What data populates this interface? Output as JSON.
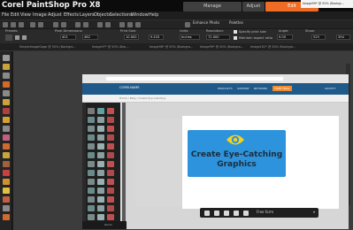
{
  "app": {
    "title": "Corel PaintShop Pro X8"
  },
  "workspace_tabs": {
    "manage": "Manage",
    "adjust": "Adjust",
    "edit": "Edit"
  },
  "menu": [
    "File",
    "Edit",
    "View",
    "Image",
    "Adjust",
    "Effects",
    "Layers",
    "Objects",
    "Selections",
    "Window",
    "Help"
  ],
  "toolbar": {
    "enhance_photo": "Enhance Photo",
    "palettes": "Palettes"
  },
  "tool_options": {
    "presets_label": "Presets:",
    "pixel_dimensions_label": "Pixel Dimensions:",
    "width_value": "401",
    "height_value": "462",
    "print_size_label": "Print Size:",
    "print_w": "10.000",
    "print_h": "9.433",
    "units_label": "Units:",
    "units_value": "Inches",
    "resolution_label": "Resolution:",
    "resolution_value": "72.000 ",
    "specify_print_size": "Specify print size",
    "maintain_aspect": "Maintain aspect ratio",
    "angle_label": "Angle:",
    "angle_value": "0.00",
    "show_label": "Show:",
    "show_w": "525",
    "show_h": "394"
  },
  "doc_tabs": {
    "t1": "SimpleImageGage @ 50% (Backgro...",
    "t2": "Image97* @ 50% (Bac...",
    "t3": "Image98* @ 50% (Backgro...",
    "t4": "Image99* @ 50% (Backgro...",
    "t5": "Image101* @ 50% (Backgro...",
    "active": "Image99* @ 50% (Backgr..."
  },
  "site": {
    "logo": "CORELNAME",
    "nav": [
      "PRODUCTS",
      "SUPPORT",
      "NETWORK",
      "SOCIETY"
    ],
    "button": "FREE TRIAL",
    "breadcrumb": "Home / Blog / Create Eye-Catching"
  },
  "banner": {
    "line1": "Create Eye-Catching",
    "line2": "Graphics"
  },
  "floatbar": {
    "label": "Free form",
    "dropdown": "▾"
  },
  "zoom": {
    "label": "Zoom"
  },
  "colors": {
    "accent": "#f06b23",
    "banner": "#2c93dc",
    "eye": "#f5d21c"
  }
}
